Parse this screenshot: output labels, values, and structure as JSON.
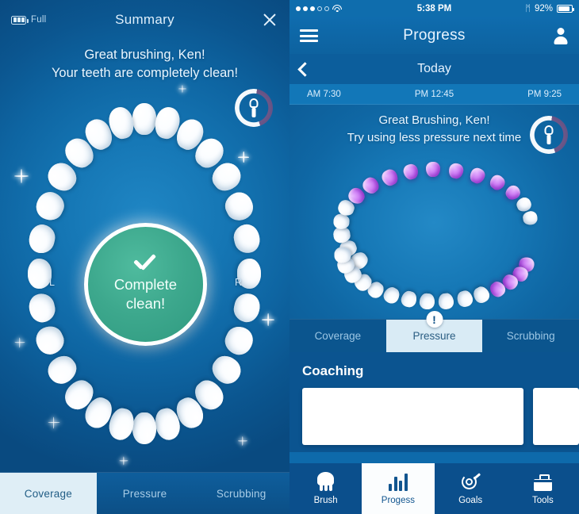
{
  "left_panel": {
    "battery": {
      "icon": "battery-icon",
      "label": "Full"
    },
    "title": "Summary",
    "close_icon": "close-icon",
    "message_line1": "Great brushing, Ken!",
    "message_line2": "Your teeth are completely clean!",
    "side_label_left": "L",
    "side_label_right": "R",
    "badge": {
      "check_icon": "check-icon",
      "line1": "Complete",
      "line2": "clean!",
      "color": "#3da88d"
    },
    "brush_badge_icon": "toothbrush-badge-icon",
    "tabs": [
      {
        "label": "Coverage",
        "active": true
      },
      {
        "label": "Pressure",
        "active": false
      },
      {
        "label": "Scrubbing",
        "active": false
      }
    ]
  },
  "right_panel": {
    "status_bar": {
      "signal_dots_filled": 3,
      "signal_dots_total": 5,
      "wifi_icon": "wifi-icon",
      "time": "5:38 PM",
      "bluetooth_icon": "bluetooth-icon",
      "bluetooth_glyph": "ᛗ",
      "battery_percent": "92%",
      "battery_icon": "battery-icon"
    },
    "navbar": {
      "menu_icon": "hamburger-menu-icon",
      "title": "Progress",
      "profile_icon": "user-avatar-icon"
    },
    "datebar": {
      "back_icon": "chevron-left-icon",
      "title": "Today"
    },
    "timeline": [
      {
        "label": "AM 7:30"
      },
      {
        "label": "PM 12:45"
      },
      {
        "label": "PM 9:25"
      }
    ],
    "message_line1": "Great Brushing, Ken!",
    "message_line2": "Try using less pressure next time",
    "brush_badge_icon": "toothbrush-badge-icon",
    "alert_badge": "!",
    "tabs": [
      {
        "label": "Coverage",
        "active": false
      },
      {
        "label": "Pressure",
        "active": true
      },
      {
        "label": "Scrubbing",
        "active": false
      }
    ],
    "coaching_title": "Coaching",
    "bottom_nav": [
      {
        "label": "Brush",
        "icon": "tooth-icon",
        "active": false
      },
      {
        "label": "Progess",
        "icon": "bar-chart-icon",
        "active": true
      },
      {
        "label": "Goals",
        "icon": "target-icon",
        "active": false
      },
      {
        "label": "Tools",
        "icon": "toolbox-icon",
        "active": false
      }
    ]
  },
  "colors": {
    "brand_blue": "#0e6aab",
    "deep_blue": "#0b4f8c",
    "accent_green": "#3da88d",
    "pressure_purple": "#ac4ee2",
    "tab_active_bg": "#dfeef6"
  }
}
